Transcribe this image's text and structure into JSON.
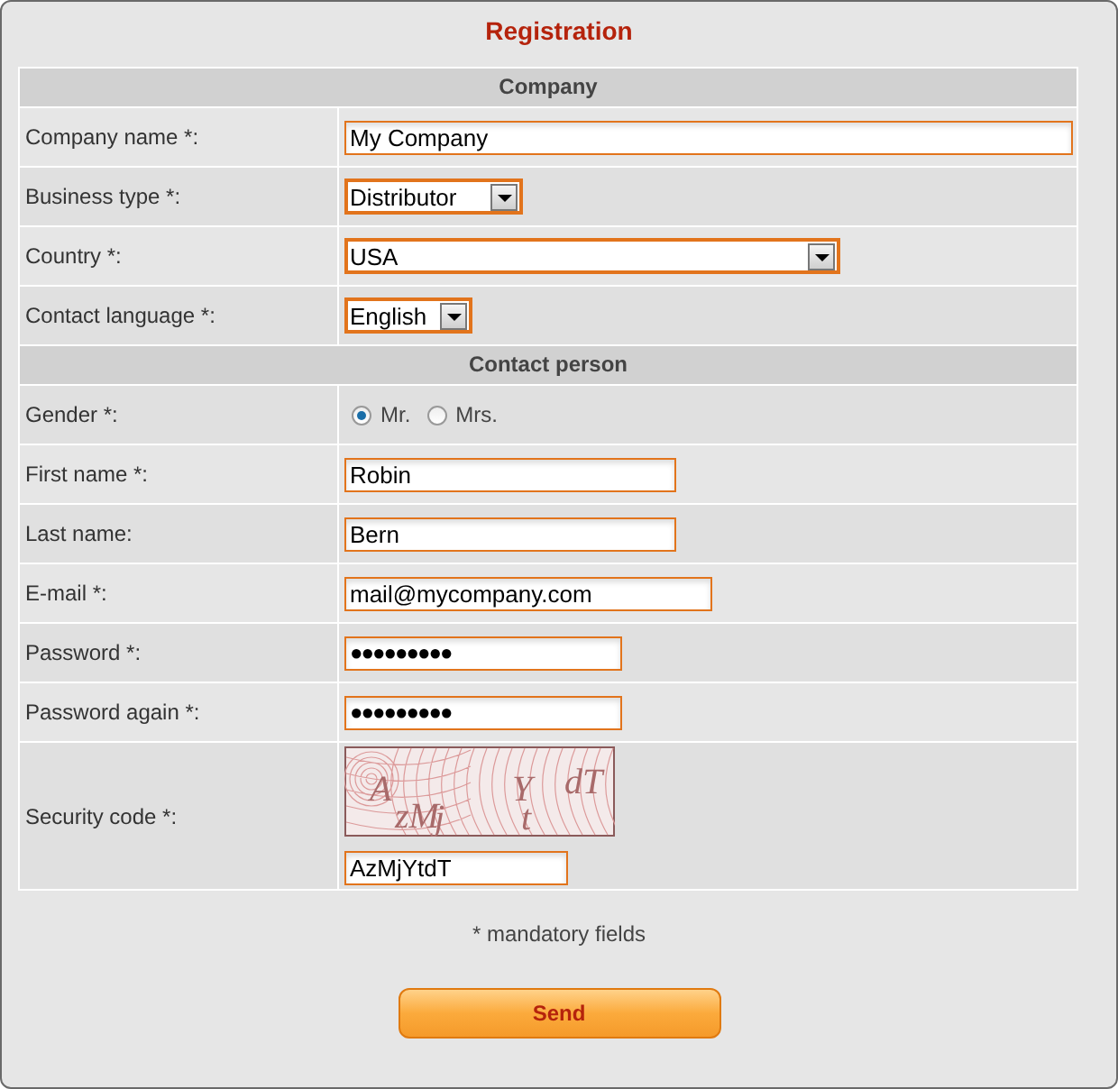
{
  "title": "Registration",
  "sections": [
    {
      "heading": "Company",
      "rows": [
        {
          "kind": "text",
          "label": "Company name *:",
          "value": "My Company"
        },
        {
          "kind": "select",
          "label": "Business type *:",
          "value": "Distributor"
        },
        {
          "kind": "select",
          "label": "Country *:",
          "value": "USA"
        },
        {
          "kind": "select",
          "label": "Contact language *:",
          "value": "English"
        }
      ]
    },
    {
      "heading": "Contact person",
      "rows": [
        {
          "kind": "radio",
          "label": "Gender *:",
          "options": [
            {
              "label": "Mr.",
              "selected": true
            },
            {
              "label": "Mrs.",
              "selected": false
            }
          ]
        },
        {
          "kind": "text",
          "label": "First name *:",
          "value": "Robin"
        },
        {
          "kind": "text",
          "label": "Last name:",
          "value": "Bern"
        },
        {
          "kind": "text",
          "label": "E-mail *:",
          "value": "mail@mycompany.com"
        },
        {
          "kind": "password",
          "label": "Password *:",
          "value": "●●●●●●●●●"
        },
        {
          "kind": "password",
          "label": "Password again *:",
          "value": "●●●●●●●●●"
        },
        {
          "kind": "captcha",
          "label": "Security code *:",
          "captcha_glyphs": [
            "A",
            "zM",
            "j",
            "Y",
            "t",
            "dT"
          ],
          "value": "AzMjYtdT"
        }
      ]
    }
  ],
  "note": "* mandatory fields",
  "button": "Send"
}
